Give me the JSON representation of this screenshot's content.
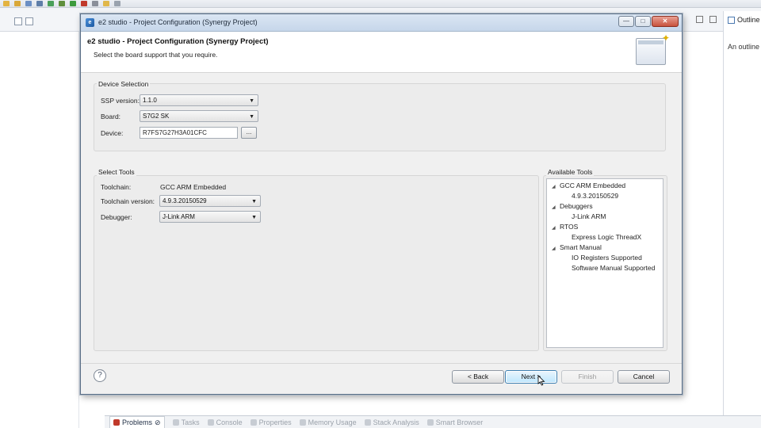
{
  "ide": {
    "outline_tab_label": "Outline",
    "outline_text": "An outline",
    "bottom_tabs": [
      {
        "label": "Problems",
        "suffix": "⊘"
      },
      {
        "label": "Tasks"
      },
      {
        "label": "Console"
      },
      {
        "label": "Properties"
      },
      {
        "label": "Memory Usage"
      },
      {
        "label": "Stack Analysis"
      },
      {
        "label": "Smart Browser"
      }
    ]
  },
  "dialog": {
    "window_title": "e2 studio - Project Configuration  (Synergy Project)",
    "header_title": "e2 studio - Project Configuration  (Synergy Project)",
    "header_description": "Select the board support that you require.",
    "device_selection": {
      "group_label": "Device Selection",
      "ssp_version_label": "SSP version:",
      "ssp_version_value": "1.1.0",
      "board_label": "Board:",
      "board_value": "S7G2 SK",
      "device_label": "Device:",
      "device_value": "R7FS7G27H3A01CFC",
      "browse_label": "..."
    },
    "select_tools": {
      "group_label": "Select Tools",
      "toolchain_label": "Toolchain:",
      "toolchain_value": "GCC ARM Embedded",
      "toolchain_version_label": "Toolchain version:",
      "toolchain_version_value": "4.9.3.20150529",
      "debugger_label": "Debugger:",
      "debugger_value": "J-Link ARM"
    },
    "available_tools": {
      "group_label": "Available Tools",
      "nodes": [
        {
          "label": "GCC ARM Embedded",
          "children": [
            "4.9.3.20150529"
          ]
        },
        {
          "label": "Debuggers",
          "children": [
            "J-Link ARM"
          ]
        },
        {
          "label": "RTOS",
          "children": [
            "Express Logic ThreadX"
          ]
        },
        {
          "label": "Smart Manual",
          "children": [
            "IO Registers Supported",
            "Software Manual Supported"
          ]
        }
      ]
    },
    "buttons": {
      "help": "?",
      "back": "< Back",
      "next": "Next >",
      "finish": "Finish",
      "cancel": "Cancel"
    }
  }
}
